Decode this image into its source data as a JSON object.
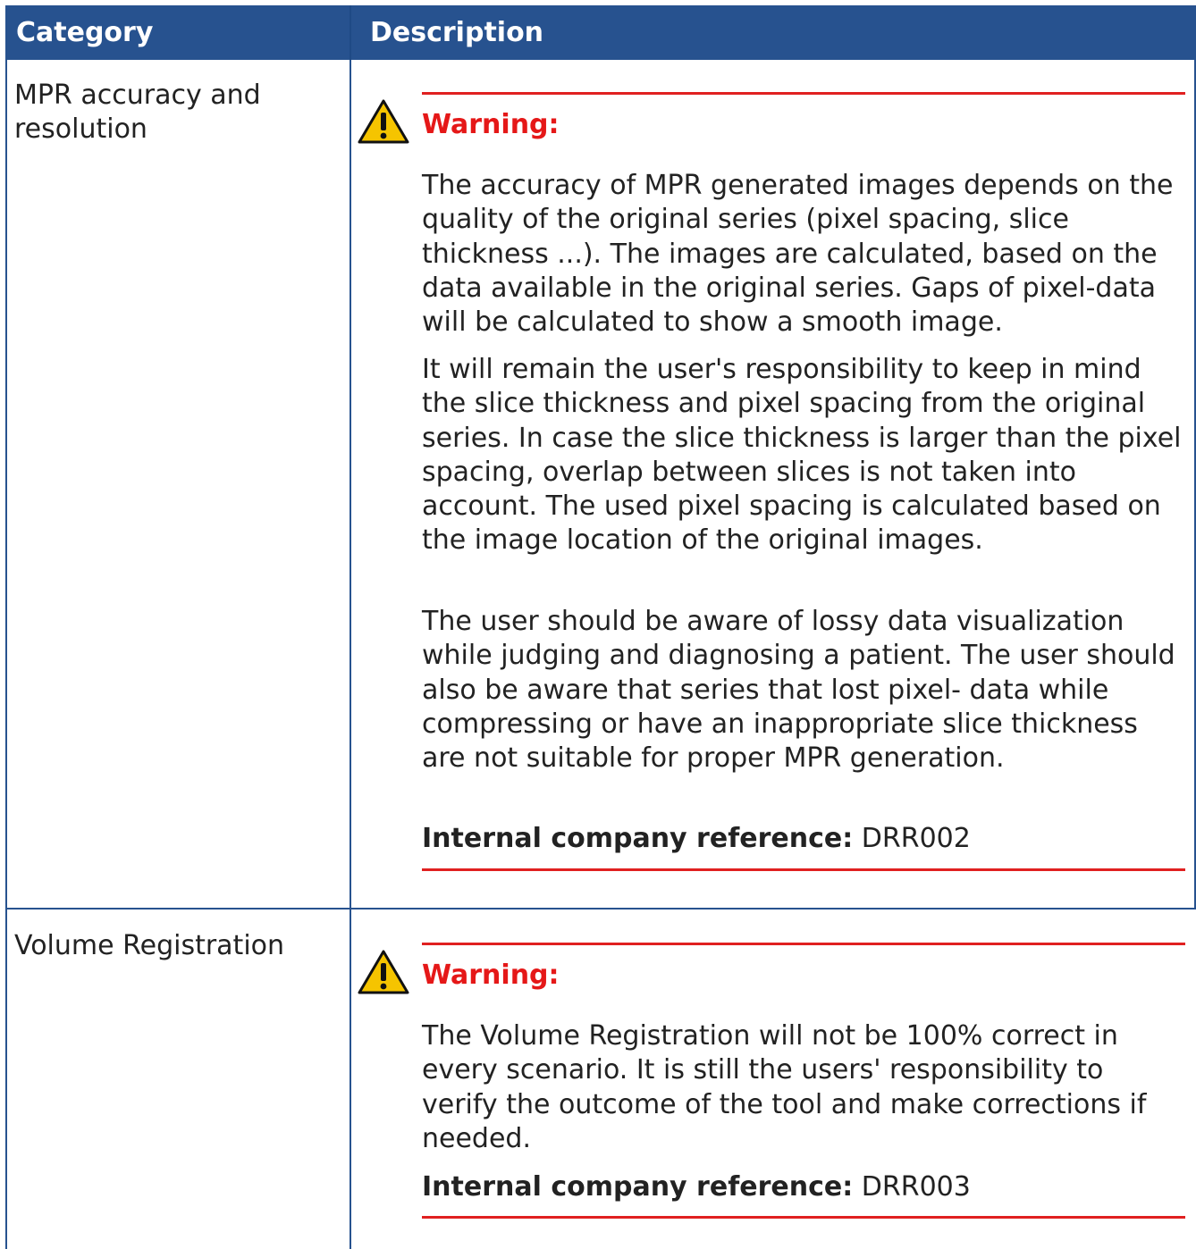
{
  "header": {
    "category_label": "Category",
    "description_label": "Description"
  },
  "rows": [
    {
      "category": "MPR accuracy and resolution",
      "warning_title": "Warning:",
      "paragraphs": [
        "The accuracy of MPR generated images depends on the quality of the original series (pixel spacing, slice thickness ...). The images are calculated, based on the data available in the original series. Gaps of pixel-data will be calculated to show a smooth image.",
        "It will remain the user's responsibility to keep in mind the slice thickness and pixel spacing from the original series. In case the slice thickness is larger than the pixel spacing, overlap between slices is not taken into account. The used pixel spacing is calculated based on the image location of the original images.",
        "The user should be aware of lossy data visualization while judging and diagnosing a patient. The user should also be aware that series that lost pixel- data while compressing or have an inappropriate slice thickness are not suitable for proper MPR generation."
      ],
      "reference_label": "Internal company reference:",
      "reference_value": "DRR002"
    },
    {
      "category": "Volume Registration",
      "warning_title": "Warning:",
      "paragraphs": [
        "The Volume Registration will not be 100% correct in every scenario. It is still the users' responsibility to verify the outcome of the tool and make corrections if needed."
      ],
      "reference_label": "Internal company reference:",
      "reference_value": "DRR003"
    }
  ],
  "colors": {
    "header_bg": "#27528f",
    "warning_red": "#e51818",
    "rule_red": "#e02020",
    "warning_icon_fill": "#f5c400"
  },
  "icons": {
    "warning": "warning-triangle-icon"
  }
}
